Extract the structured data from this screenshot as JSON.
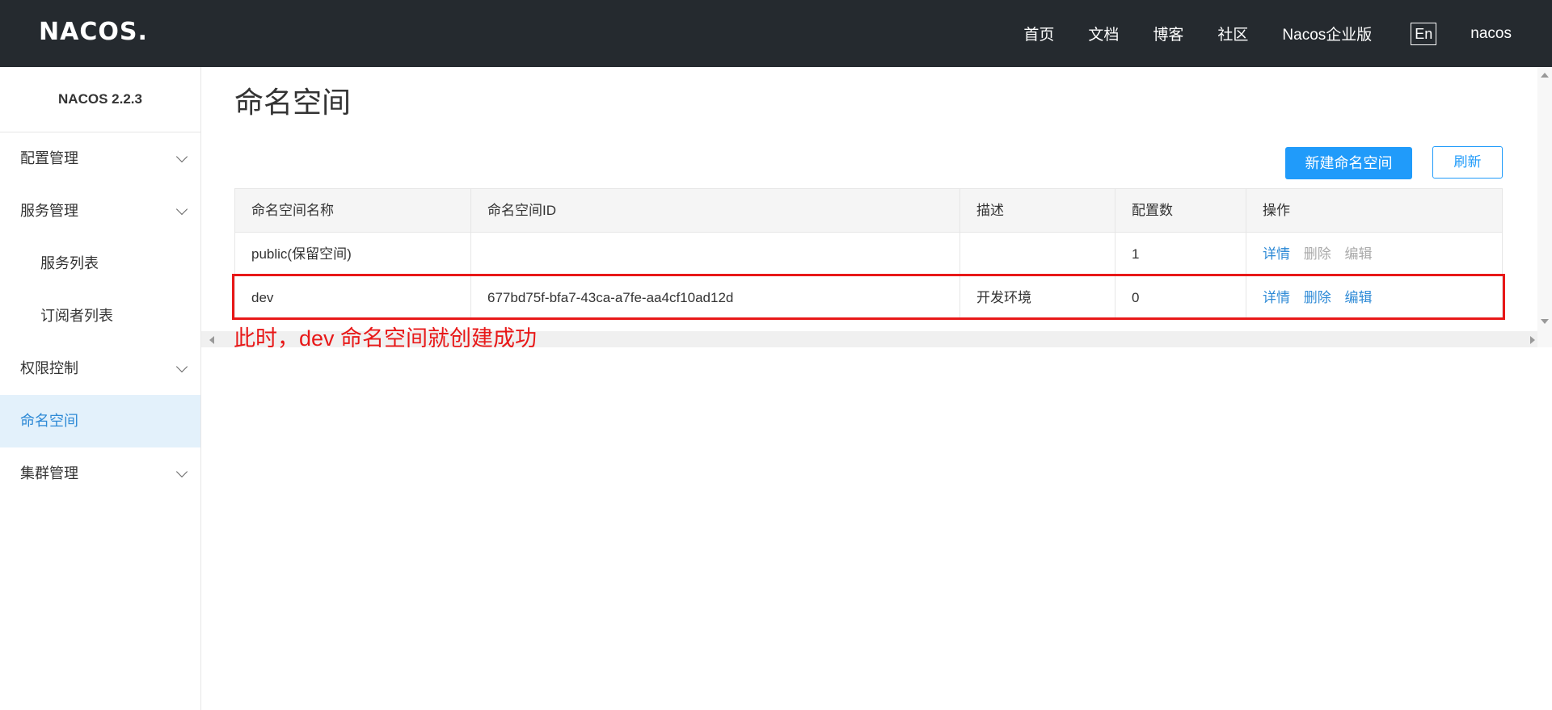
{
  "header": {
    "logo": "NACOS.",
    "nav": [
      "首页",
      "文档",
      "博客",
      "社区",
      "Nacos企业版"
    ],
    "lang": "En",
    "user": "nacos"
  },
  "sidebar": {
    "version": "NACOS 2.2.3",
    "items": [
      {
        "label": "配置管理",
        "has_children": true
      },
      {
        "label": "服务管理",
        "has_children": true
      },
      {
        "label": "服务列表",
        "sub": true
      },
      {
        "label": "订阅者列表",
        "sub": true
      },
      {
        "label": "权限控制",
        "has_children": true
      },
      {
        "label": "命名空间",
        "active": true
      },
      {
        "label": "集群管理",
        "has_children": true
      }
    ]
  },
  "main": {
    "title": "命名空间",
    "buttons": {
      "create": "新建命名空间",
      "refresh": "刷新"
    },
    "table": {
      "headers": [
        "命名空间名称",
        "命名空间ID",
        "描述",
        "配置数",
        "操作"
      ],
      "rows": [
        {
          "name": "public(保留空间)",
          "id": "",
          "desc": "",
          "count": "1",
          "actions": {
            "detail": "详情",
            "delete": "删除",
            "edit": "编辑"
          },
          "readonly": true
        },
        {
          "name": "dev",
          "id": "677bd75f-bfa7-43ca-a7fe-aa4cf10ad12d",
          "desc": "开发环境",
          "count": "0",
          "actions": {
            "detail": "详情",
            "delete": "删除",
            "edit": "编辑"
          },
          "readonly": false
        }
      ]
    },
    "annotation": "此时，dev 命名空间就创建成功"
  },
  "colors": {
    "topbar": "#252a2f",
    "primary": "#209bfa",
    "link": "#2e8ad6",
    "highlight": "#e81818",
    "active_bg": "#e3f1fb"
  }
}
